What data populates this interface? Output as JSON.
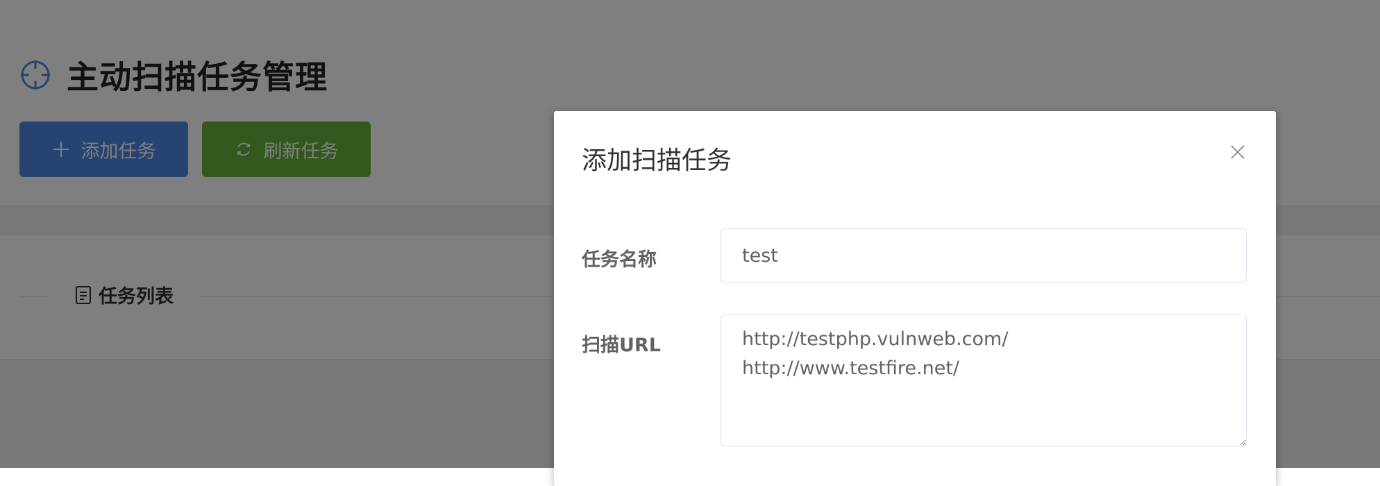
{
  "page": {
    "title": "主动扫描任务管理",
    "title_icon": "crosshair-icon",
    "toolbar": {
      "add_label": "添加任务",
      "add_icon": "plus-icon",
      "refresh_label": "刷新任务",
      "refresh_icon": "refresh-icon"
    },
    "section": {
      "label": "任务列表",
      "icon": "document-icon"
    }
  },
  "dialog": {
    "title": "添加扫描任务",
    "close_icon": "close-icon",
    "fields": {
      "name_label": "任务名称",
      "name_value": "test",
      "url_label": "扫描URL",
      "url_value": "http://testphp.vulnweb.com/\nhttp://www.testfire.net/"
    }
  },
  "colors": {
    "primary": "#4f87e2",
    "success": "#67b03a",
    "overlay": "rgba(0,0,0,0.5)"
  }
}
